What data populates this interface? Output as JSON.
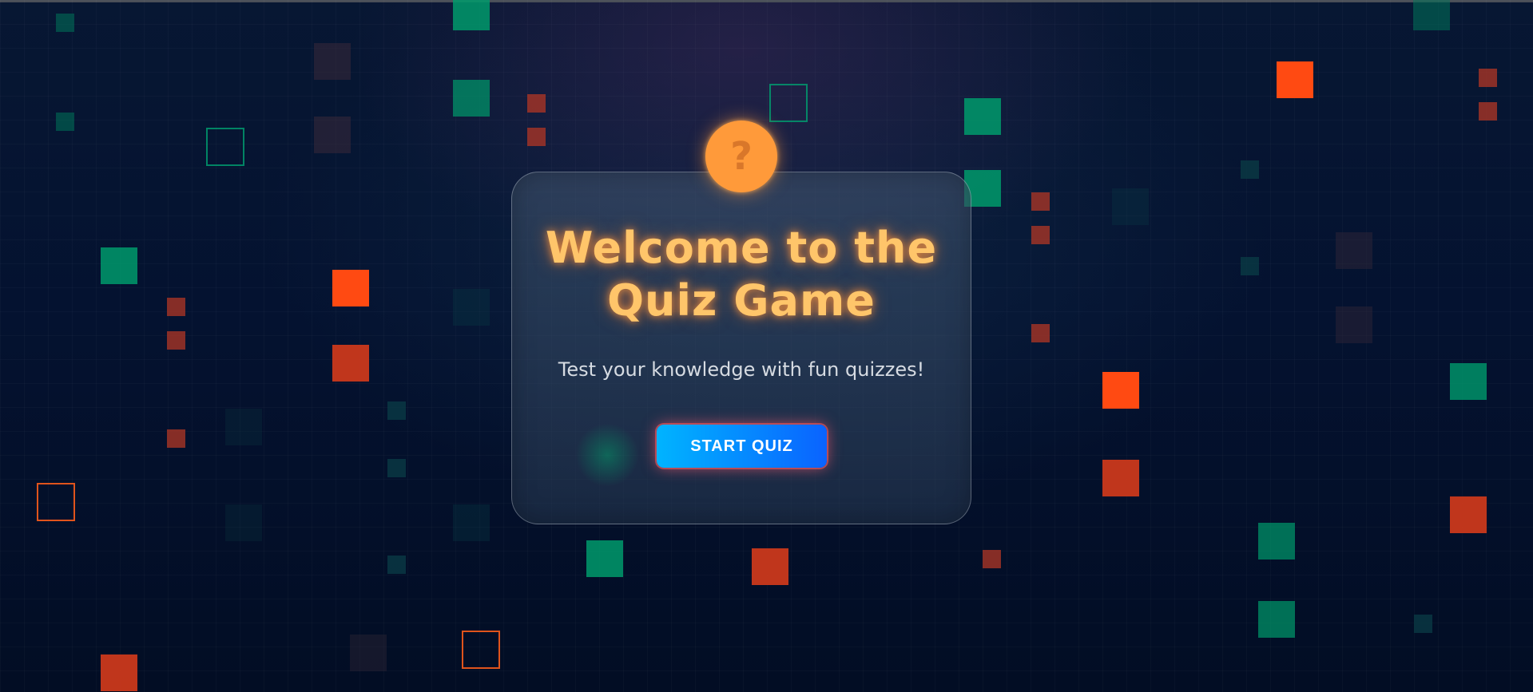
{
  "badge": {
    "glyph": "?",
    "icon": "question-mark-icon"
  },
  "title": {
    "line1": "Welcome to the",
    "line2": "Quiz Game"
  },
  "subtitle": "Test your knowledge with fun quizzes!",
  "start_button": {
    "label": "START QUIZ"
  },
  "colors": {
    "accent_orange": "#ff9a3a",
    "title_color": "#ffc56a",
    "button_gradient_start": "#00b4ff",
    "button_gradient_end": "#0a63ff",
    "background": "#03122b"
  }
}
